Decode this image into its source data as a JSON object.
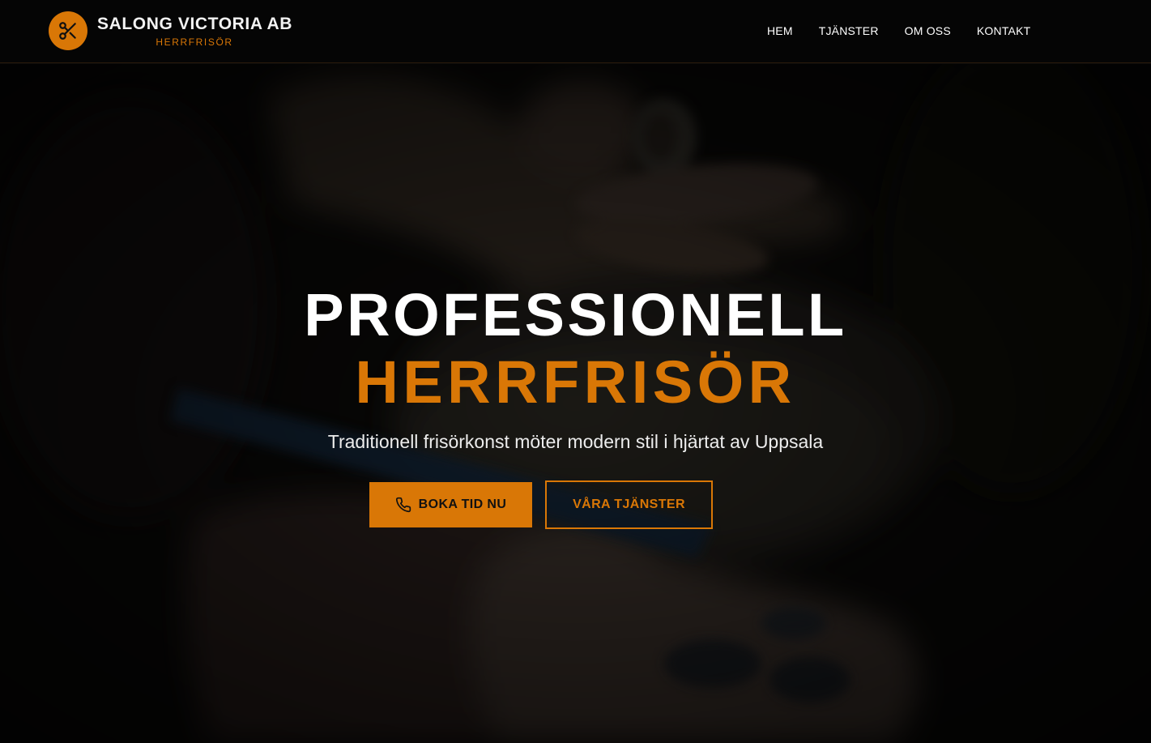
{
  "brand": {
    "name": "SALONG VICTORIA AB",
    "tagline": "HERRFRISÖR",
    "logo_icon": "scissors-icon"
  },
  "nav": {
    "items": [
      {
        "label": "HEM"
      },
      {
        "label": "TJÄNSTER"
      },
      {
        "label": "OM OSS"
      },
      {
        "label": "KONTAKT"
      }
    ]
  },
  "hero": {
    "title_line1": "PROFESSIONELL",
    "title_line2": "HERRFRISÖR",
    "subtitle": "Traditionell frisörkonst möter modern stil i hjärtat av Uppsala",
    "primary_button": {
      "label": "BOKA TID NU",
      "icon": "phone-icon"
    },
    "secondary_button": {
      "label": "VÅRA TJÄNSTER"
    },
    "background_image": "barber-cutting-hair-photo"
  },
  "colors": {
    "accent": "#d97706",
    "header_bg": "#050505",
    "text_light": "#ffffff"
  }
}
